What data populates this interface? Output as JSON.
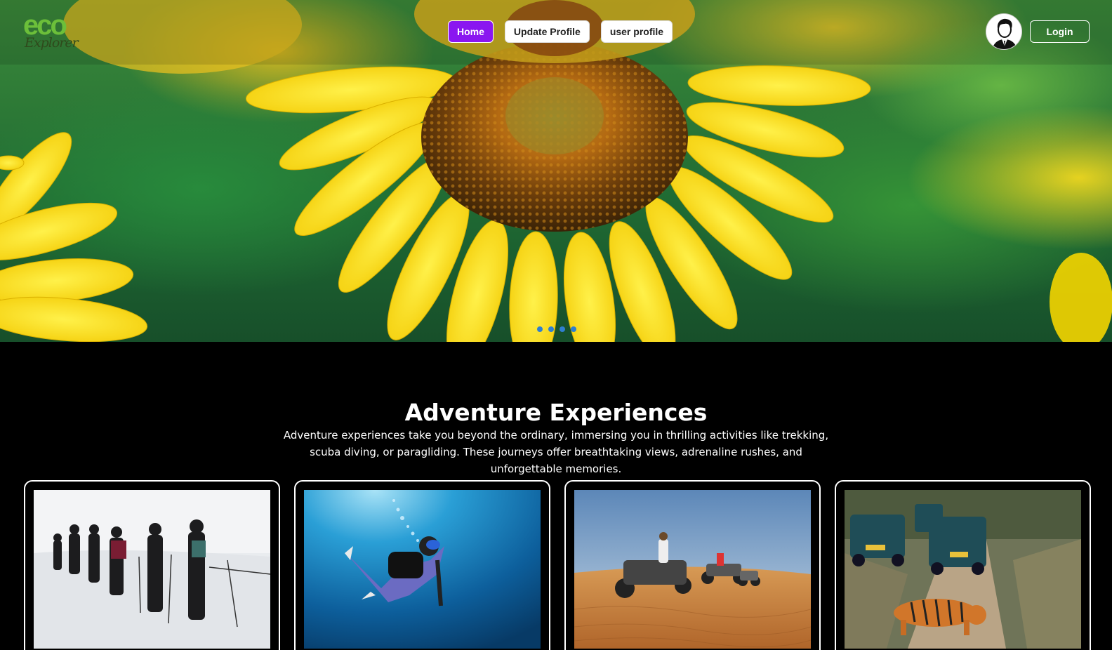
{
  "logo": {
    "line1": "eco",
    "line2": "Explorer"
  },
  "nav": {
    "items": [
      {
        "label": "Home",
        "active": true
      },
      {
        "label": "Update Profile",
        "active": false
      },
      {
        "label": "user profile",
        "active": false
      }
    ],
    "login_label": "Login",
    "avatar_icon": "user-avatar-icon"
  },
  "hero": {
    "slide_count": 4,
    "image": "sunflower"
  },
  "section": {
    "title": "Adventure Experiences",
    "description": "Adventure experiences take you beyond the ordinary, immersing you in thrilling activities like trekking, scuba diving, or paragliding. These journeys offer breathtaking views, adrenaline rushes, and unforgettable memories."
  },
  "cards": [
    {
      "image": "snow-trekking-photo"
    },
    {
      "image": "scuba-diving-photo"
    },
    {
      "image": "desert-atv-photo"
    },
    {
      "image": "jungle-safari-tiger-photo"
    }
  ],
  "colors": {
    "accent": "#8a16f0",
    "dot": "#2f7fd0",
    "background": "#000000"
  }
}
